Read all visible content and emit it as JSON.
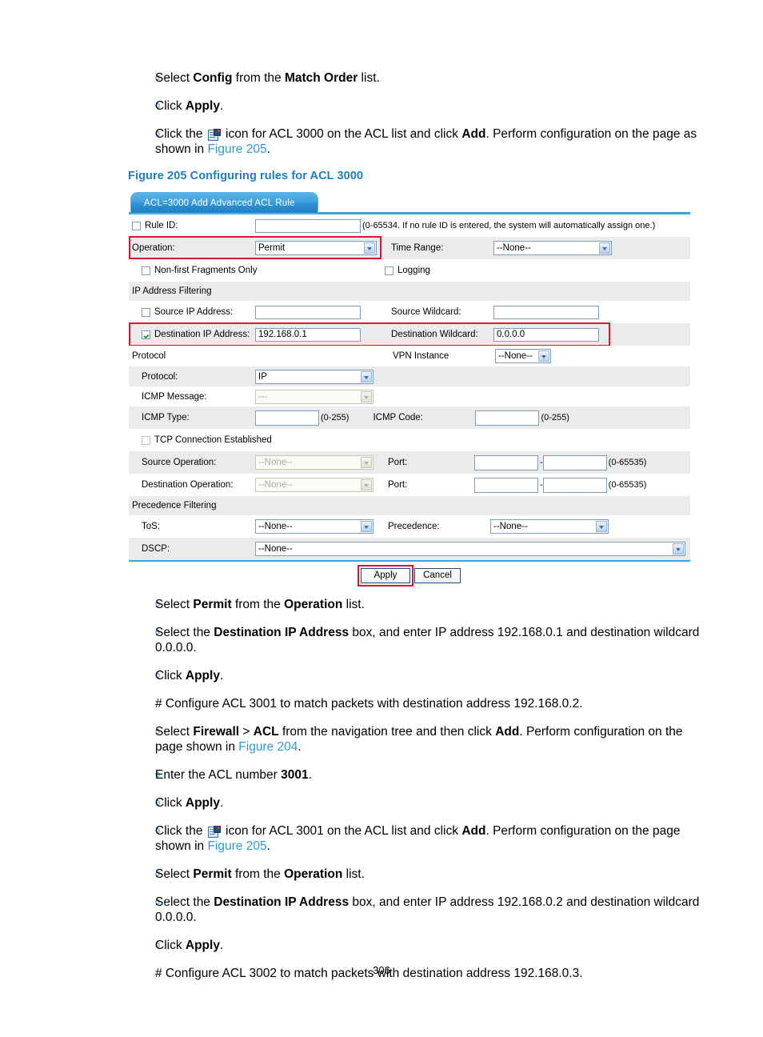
{
  "document": {
    "page_number": "306",
    "figure_caption": "Figure 205 Configuring rules for ACL 3000",
    "top_steps": [
      {
        "id": "s1",
        "parts": [
          "Select ",
          "Config",
          " from the ",
          "Match Order",
          " list."
        ]
      },
      {
        "id": "s2",
        "parts": [
          "Click ",
          "Apply",
          "."
        ]
      },
      {
        "id": "s3",
        "parts": [
          "Click the ",
          "icon",
          " icon for ACL 3000 on the ACL list and click ",
          "Add",
          ". Perform configuration on the page as shown in ",
          "Figure 205",
          "."
        ]
      }
    ],
    "bottom_steps": [
      {
        "id": "b1",
        "text": "Select Permit from the Operation list."
      },
      {
        "id": "b2",
        "text": "Select the Destination IP Address box, and enter IP address 192.168.0.1 and destination wildcard 0.0.0.0."
      },
      {
        "id": "b3",
        "text": "Click Apply."
      },
      {
        "id": "b4",
        "text": "Select Firewall > ACL from the navigation tree and then click Add. Perform configuration on the page shown in Figure 204."
      },
      {
        "id": "b5",
        "text": "Enter the ACL number 3001."
      },
      {
        "id": "b6",
        "text": "Click Apply."
      },
      {
        "id": "b7",
        "text": "Click the icon for ACL 3001 on the ACL list and click Add. Perform configuration on the page shown in Figure 205."
      },
      {
        "id": "b8",
        "text": "Select Permit from the Operation list."
      },
      {
        "id": "b9",
        "text": "Select the Destination IP Address box, and enter IP address 192.168.0.2 and destination wildcard 0.0.0.0."
      },
      {
        "id": "b10",
        "text": "Click Apply."
      }
    ],
    "paragraphs": {
      "acl3001": "# Configure ACL 3001 to match packets with destination address 192.168.0.2.",
      "acl3002": "# Configure ACL 3002 to match packets with destination address 192.168.0.3."
    }
  },
  "figure": {
    "tab_title": "ACL=3000 Add Advanced ACL Rule",
    "rule_id": {
      "label": "Rule ID:",
      "checked": false,
      "value": "",
      "hint": "(0-65534. If no rule ID is entered, the system will automatically assign one.)"
    },
    "operation": {
      "label": "Operation:",
      "value": "Permit"
    },
    "time_range": {
      "label": "Time Range:",
      "value": "--None--"
    },
    "non_first_fragments": {
      "label": "Non-first Fragments Only",
      "checked": false
    },
    "logging": {
      "label": "Logging",
      "checked": false
    },
    "sections": {
      "ip_filtering": "IP Address Filtering",
      "protocol": "Protocol",
      "precedence": "Precedence Filtering"
    },
    "source_ip": {
      "label": "Source IP Address:",
      "checked": false,
      "value": ""
    },
    "source_wildcard": {
      "label": "Source Wildcard:",
      "value": ""
    },
    "destination_ip": {
      "label": "Destination IP Address:",
      "checked": true,
      "value": "192.168.0.1"
    },
    "destination_wildcard": {
      "label": "Destination Wildcard:",
      "value": "0.0.0.0"
    },
    "vpn_instance": {
      "label": "VPN Instance",
      "value": "--None--"
    },
    "protocol_field": {
      "label": "Protocol:",
      "value": "IP"
    },
    "icmp_message": {
      "label": "ICMP Message:",
      "value": "---"
    },
    "icmp_type": {
      "label": "ICMP Type:",
      "value": "",
      "range": "(0-255)"
    },
    "icmp_code": {
      "label": "ICMP Code:",
      "value": "",
      "range": "(0-255)"
    },
    "tcp_established": {
      "label": "TCP Connection Established",
      "checked": false
    },
    "source_operation": {
      "label": "Source Operation:",
      "value": "--None--"
    },
    "source_port": {
      "label": "Port:",
      "from": "",
      "to": "",
      "range": "(0-65535)",
      "sep": "-"
    },
    "destination_operation": {
      "label": "Destination Operation:",
      "value": "--None--"
    },
    "destination_port": {
      "label": "Port:",
      "from": "",
      "to": "",
      "range": "(0-65535)",
      "sep": "-"
    },
    "tos": {
      "label": "ToS:",
      "value": "--None--"
    },
    "precedence_field": {
      "label": "Precedence:",
      "value": "--None--"
    },
    "dscp": {
      "label": "DSCP:",
      "value": "--None--"
    },
    "buttons": {
      "apply": "Apply",
      "cancel": "Cancel"
    },
    "colors": {
      "tab_blue": "#2e93d4",
      "rule_border": "#3aa3de",
      "highlight_red": "#e8112d",
      "row_shade": "#ebebeb",
      "link_blue": "#2e9bd6",
      "caption_blue": "#1b7fc4"
    }
  }
}
